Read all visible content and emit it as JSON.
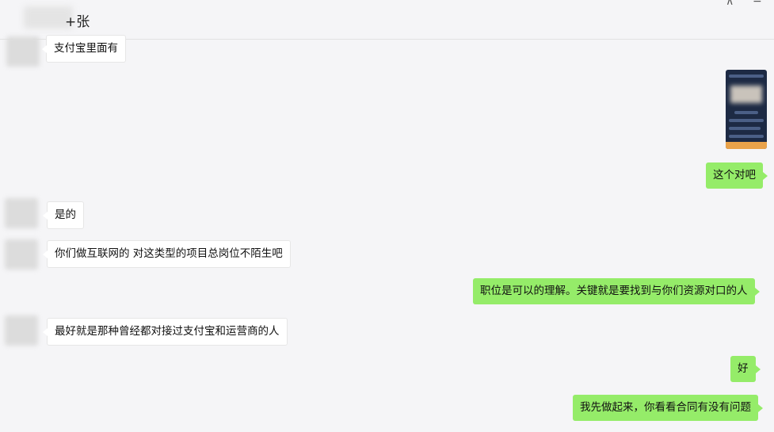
{
  "chat": {
    "title": "+张",
    "controls": {
      "pin_glyph": "⊼",
      "minimize_glyph": "−"
    },
    "messages": [
      {
        "side": "left",
        "text": "支付宝里面有"
      },
      {
        "side": "right",
        "type": "image",
        "icon": "phone-screenshot-thumbnail"
      },
      {
        "side": "right",
        "text": "这个对吧"
      },
      {
        "side": "left",
        "text": "是的"
      },
      {
        "side": "left",
        "text": "你们做互联网的 对这类型的项目总岗位不陌生吧"
      },
      {
        "side": "right",
        "text": "职位是可以的理解。关键就是要找到与你们资源对口的人"
      },
      {
        "side": "left",
        "text": "最好就是那种曾经都对接过支付宝和运营商的人"
      },
      {
        "side": "right",
        "text": "好"
      },
      {
        "side": "right",
        "text": "我先做起来，你看看合同有没有问题"
      }
    ]
  },
  "colors": {
    "outgoing_bubble": "#95ec69",
    "incoming_bubble": "#ffffff",
    "background": "#f5f5f7"
  }
}
